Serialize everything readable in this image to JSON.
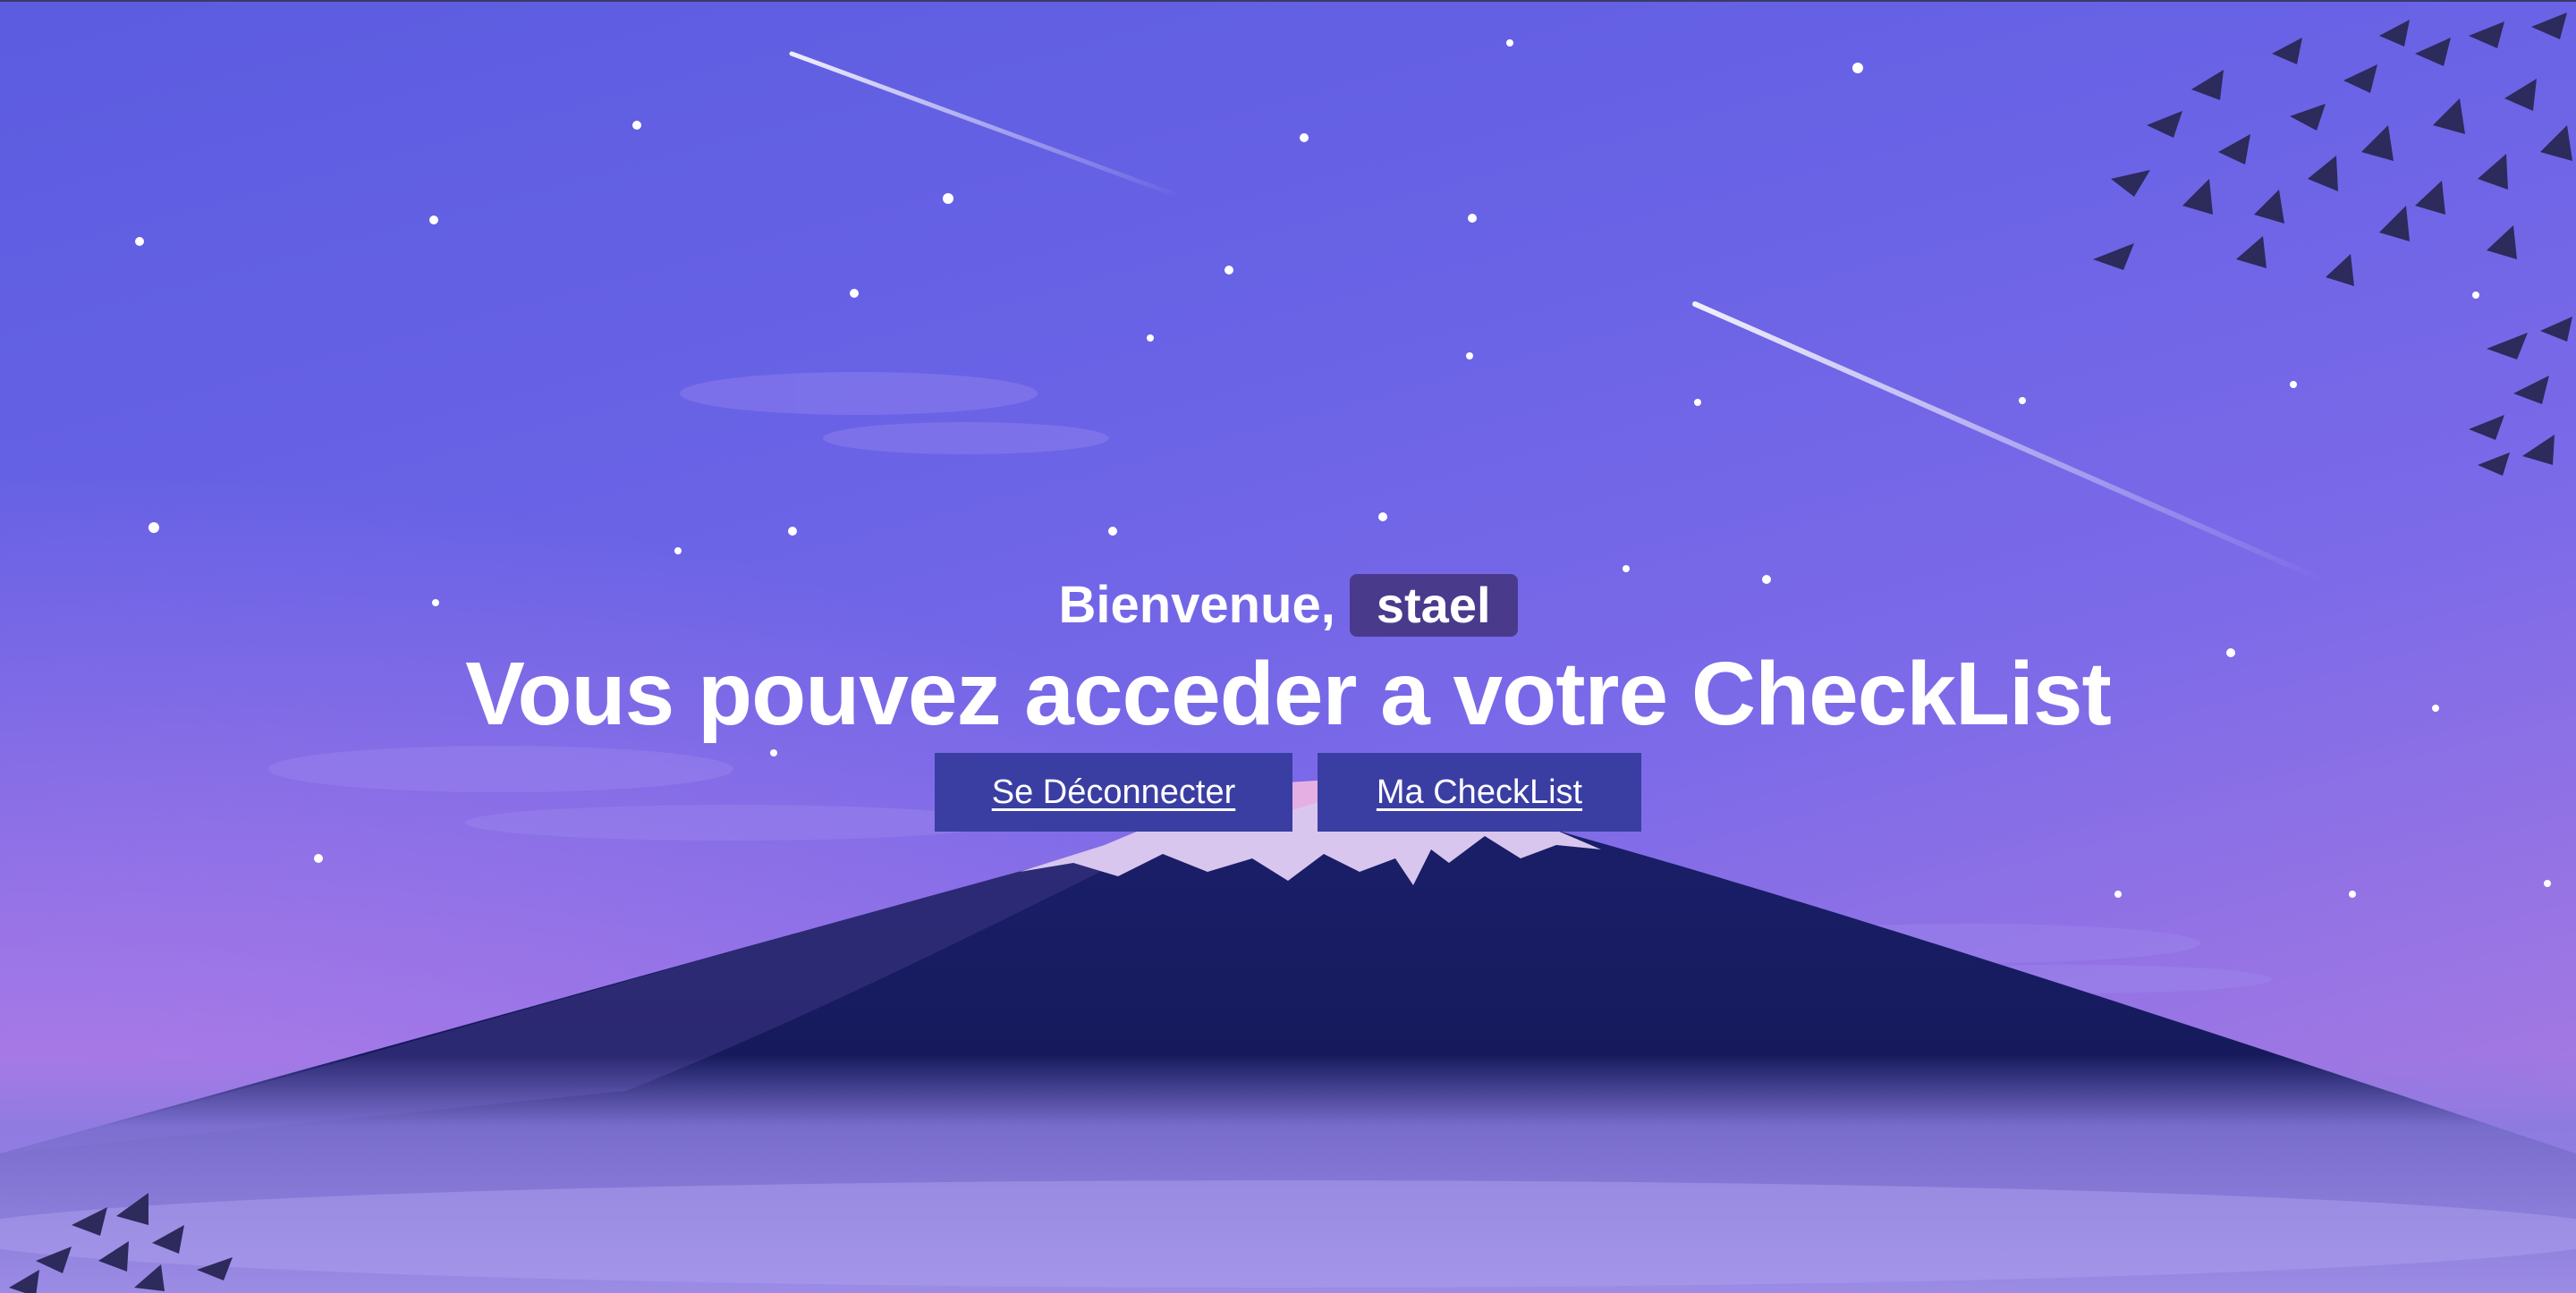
{
  "welcome": {
    "greeting": "Bienvenue,",
    "username": "stael"
  },
  "headline": "Vous pouvez acceder a votre CheckList",
  "actions": {
    "logout_label": "Se Déconnecter",
    "checklist_label": "Ma CheckList"
  },
  "colors": {
    "sky_top": "#5b5ce0",
    "sky_bottom_left": "#b27ee0",
    "mountain": "#141a5c",
    "button_bg": "#3a3ea3",
    "username_badge": "#4a3a8c",
    "text": "#ffffff"
  }
}
